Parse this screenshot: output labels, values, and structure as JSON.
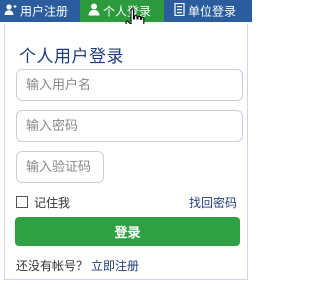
{
  "tabs": [
    {
      "label": "用户注册",
      "icon": "user-plus-icon"
    },
    {
      "label": "个人登录",
      "icon": "person-icon",
      "active": true
    },
    {
      "label": "单位登录",
      "icon": "building-icon"
    }
  ],
  "login": {
    "title": "个人用户登录",
    "username_placeholder": "输入用户名",
    "password_placeholder": "输入密码",
    "captcha_placeholder": "输入验证码",
    "remember_label": "记住我",
    "forgot_label": "找回密码",
    "submit_label": "登录",
    "no_account_label": "还没有帐号？",
    "register_now_label": "立即注册"
  },
  "colors": {
    "tabbar": "#2a5c9e",
    "active_tab": "#2e9a3e",
    "title": "#1f3d7a",
    "button": "#2fa043"
  }
}
